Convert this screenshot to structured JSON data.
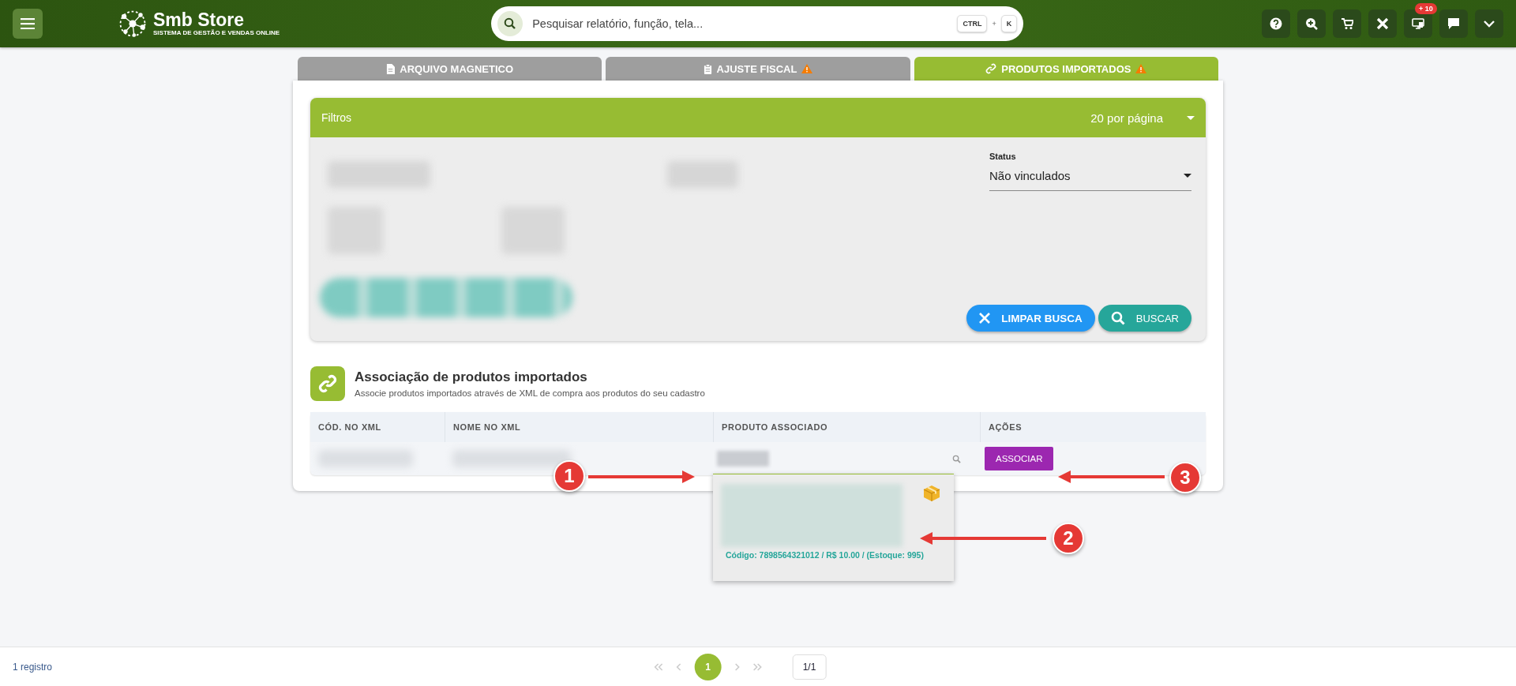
{
  "header": {
    "logo_title": "Smb Store",
    "logo_subtitle": "SISTEMA DE GESTÃO E VENDAS ONLINE",
    "search": {
      "placeholder": "Pesquisar relatório, função, tela..."
    },
    "shortcut": [
      "CTRL",
      "+",
      "K"
    ],
    "notification_badge": "+ 10"
  },
  "tabs": [
    {
      "label": "ARQUIVO MAGNETICO",
      "selected": false,
      "warning": false
    },
    {
      "label": "AJUSTE FISCAL",
      "selected": false,
      "warning": true
    },
    {
      "label": "PRODUTOS IMPORTADOS",
      "selected": true,
      "warning": true
    }
  ],
  "filters": {
    "title": "Filtros",
    "per_page": "20 por página",
    "status": {
      "label": "Status",
      "value": "Não vinculados"
    },
    "buttons": [
      {
        "label": "LIMPAR BUSCA",
        "kind": "clear"
      },
      {
        "label": "BUSCAR",
        "kind": "search"
      }
    ]
  },
  "section": {
    "title": "Associação de produtos importados",
    "subtitle": "Associe produtos importados através de XML de compra aos produtos do seu cadastro"
  },
  "table": {
    "columns": [
      "CÓD. NO XML",
      "NOME NO XML",
      "PRODUTO ASSOCIADO",
      "AÇÕES"
    ],
    "action": "ASSOCIAR"
  },
  "suggestion": {
    "details": "Código: 7898564321012 / R$ 10.00 / (Estoque: 995)"
  },
  "annotations": [
    "1",
    "2",
    "3"
  ],
  "footer": {
    "count": "1 registro",
    "pages": [
      {
        "label": "1",
        "selected": true
      }
    ],
    "page_of": "1/1"
  }
}
